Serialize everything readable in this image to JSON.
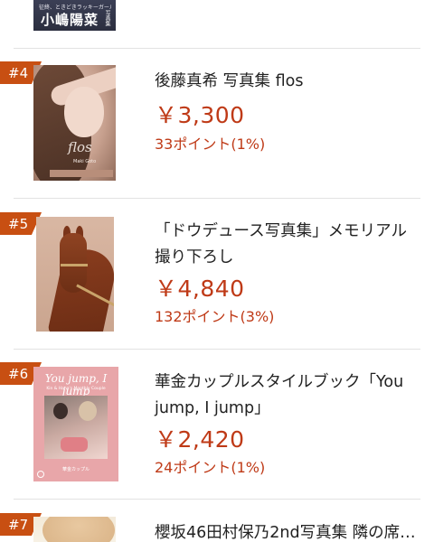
{
  "items": [
    {
      "partial_cover_text": {
        "small": "征終、ときどきラッキーガール◎",
        "name": "小嶋陽菜",
        "tag": "写真集"
      }
    },
    {
      "rank": "#4",
      "title": "後藤真希 写真集 flos",
      "price": "￥3,300",
      "points": "33ポイント(1%)",
      "cover_script": "flos",
      "cover_sub": "Maki Goto"
    },
    {
      "rank": "#5",
      "title": "「ドウデュース写真集」メモリアル撮り下ろし",
      "price": "￥4,840",
      "points": "132ポイント(3%)"
    },
    {
      "rank": "#6",
      "title": "華金カップルスタイルブック「You jump, I jump」",
      "price": "￥2,420",
      "points": "24ポイント(1%)",
      "cover_title": "You jump, I jump",
      "cover_sub": "Kin & Hana's Monthly Couple",
      "cover_foot": "華金カップル"
    },
    {
      "rank": "#7",
      "title": "櫻坂46田村保乃2nd写真集 隣の席…"
    }
  ],
  "colors": {
    "accent": "#c84f12",
    "price": "#bf3a17",
    "divider": "#e2e2e2"
  }
}
